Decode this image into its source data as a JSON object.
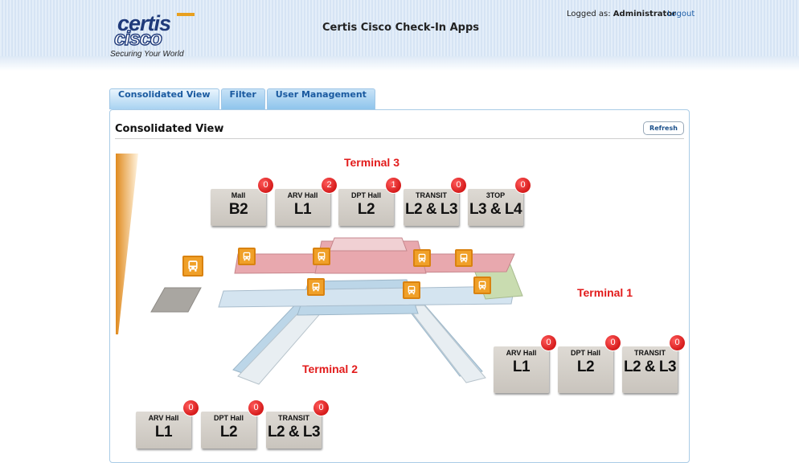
{
  "header": {
    "logo_brand": "certis",
    "logo_sub": "cisco",
    "logo_tagline": "Securing Your World",
    "app_title": "Certis Cisco Check-In Apps",
    "login_prefix": "Logged as:",
    "login_user": "Administrator",
    "logout_label": "Logout"
  },
  "tabs": [
    {
      "label": "Consolidated View",
      "active": true
    },
    {
      "label": "Filter",
      "active": false
    },
    {
      "label": "User Management",
      "active": false
    }
  ],
  "panel": {
    "title": "Consolidated View",
    "refresh_label": "Refresh"
  },
  "map": {
    "terminal3": {
      "label": "Terminal 3",
      "cards": [
        {
          "label": "Mall",
          "level": "B2",
          "count": "0"
        },
        {
          "label": "ARV Hall",
          "level": "L1",
          "count": "2"
        },
        {
          "label": "DPT Hall",
          "level": "L2",
          "count": "1"
        },
        {
          "label": "TRANSIT",
          "level": "L2 & L3",
          "count": "0"
        },
        {
          "label": "3TOP",
          "level": "L3 & L4",
          "count": "0"
        }
      ]
    },
    "terminal1": {
      "label": "Terminal 1",
      "cards": [
        {
          "label": "ARV Hall",
          "level": "L1",
          "count": "0"
        },
        {
          "label": "DPT Hall",
          "level": "L2",
          "count": "0"
        },
        {
          "label": "TRANSIT",
          "level": "L2 & L3",
          "count": "0"
        }
      ]
    },
    "terminal2": {
      "label": "Terminal 2",
      "cards": [
        {
          "label": "ARV Hall",
          "level": "L1",
          "count": "0"
        },
        {
          "label": "DPT Hall",
          "level": "L2",
          "count": "0"
        },
        {
          "label": "TRANSIT",
          "level": "L2 & L3",
          "count": "0"
        }
      ]
    },
    "bus_icon": "bus-icon",
    "colors": {
      "terminal_label": "#e21b1b",
      "badge": "#d40000",
      "bus": "#f0a028",
      "t3_floor": "#e8a8ae",
      "t2_floor": "#bcd6e8",
      "t1_floor": "#c9dcb0"
    }
  }
}
